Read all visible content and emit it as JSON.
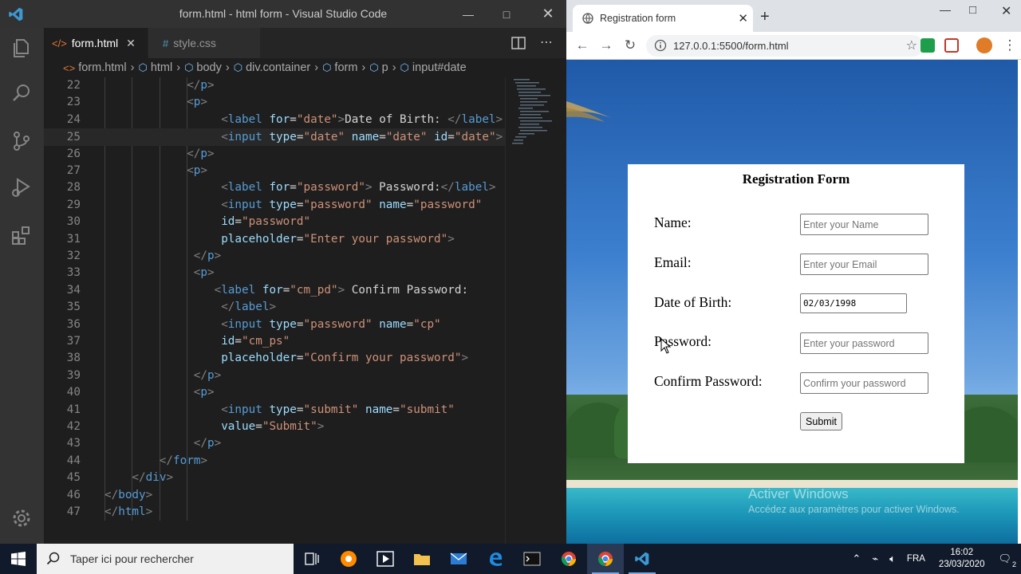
{
  "vscode": {
    "window_title": "form.html - html form - Visual Studio Code",
    "tabs": [
      {
        "label": "form.html",
        "icon": "</>",
        "active": true
      },
      {
        "label": "style.css",
        "icon": "#",
        "active": false
      }
    ],
    "breadcrumb": [
      "form.html",
      "html",
      "body",
      "div.container",
      "form",
      "p",
      "input#date"
    ],
    "code_lines": [
      {
        "n": "22",
        "indent": 12,
        "tokens": [
          [
            "t",
            "</"
          ],
          [
            "n",
            "p"
          ],
          [
            "t",
            ">"
          ]
        ]
      },
      {
        "n": "23",
        "indent": 12,
        "tokens": [
          [
            "t",
            "<"
          ],
          [
            "n",
            "p"
          ],
          [
            "t",
            ">"
          ]
        ]
      },
      {
        "n": "24",
        "indent": 17,
        "tokens": [
          [
            "t",
            "<"
          ],
          [
            "n",
            "label"
          ],
          [
            "x",
            " "
          ],
          [
            "a",
            "for"
          ],
          [
            "x",
            "="
          ],
          [
            "s",
            "\"date\""
          ],
          [
            "t",
            ">"
          ],
          [
            "x",
            "Date of Birth: "
          ],
          [
            "t",
            "</"
          ],
          [
            "n",
            "label"
          ],
          [
            "t",
            ">"
          ]
        ]
      },
      {
        "n": "25",
        "indent": 17,
        "tokens": [
          [
            "t",
            "<"
          ],
          [
            "n",
            "input"
          ],
          [
            "x",
            " "
          ],
          [
            "a",
            "type"
          ],
          [
            "x",
            "="
          ],
          [
            "s",
            "\"date\""
          ],
          [
            "x",
            " "
          ],
          [
            "a",
            "name"
          ],
          [
            "x",
            "="
          ],
          [
            "s",
            "\"date\""
          ],
          [
            "x",
            " "
          ],
          [
            "a",
            "id"
          ],
          [
            "x",
            "="
          ],
          [
            "s",
            "\"date\""
          ],
          [
            "t",
            ">"
          ]
        ]
      },
      {
        "n": "26",
        "indent": 12,
        "tokens": [
          [
            "t",
            "</"
          ],
          [
            "n",
            "p"
          ],
          [
            "t",
            ">"
          ]
        ]
      },
      {
        "n": "27",
        "indent": 12,
        "tokens": [
          [
            "t",
            "<"
          ],
          [
            "n",
            "p"
          ],
          [
            "t",
            ">"
          ]
        ]
      },
      {
        "n": "28",
        "indent": 17,
        "tokens": [
          [
            "t",
            "<"
          ],
          [
            "n",
            "label"
          ],
          [
            "x",
            " "
          ],
          [
            "a",
            "for"
          ],
          [
            "x",
            "="
          ],
          [
            "s",
            "\"password\""
          ],
          [
            "t",
            ">"
          ],
          [
            "x",
            " Password:"
          ],
          [
            "t",
            "</"
          ],
          [
            "n",
            "label"
          ],
          [
            "t",
            ">"
          ]
        ]
      },
      {
        "n": "29",
        "indent": 17,
        "tokens": [
          [
            "t",
            "<"
          ],
          [
            "n",
            "input"
          ],
          [
            "x",
            " "
          ],
          [
            "a",
            "type"
          ],
          [
            "x",
            "="
          ],
          [
            "s",
            "\"password\""
          ],
          [
            "x",
            " "
          ],
          [
            "a",
            "name"
          ],
          [
            "x",
            "="
          ],
          [
            "s",
            "\"password\""
          ]
        ]
      },
      {
        "n": "30",
        "indent": 17,
        "tokens": [
          [
            "a",
            "id"
          ],
          [
            "x",
            "="
          ],
          [
            "s",
            "\"password\""
          ]
        ]
      },
      {
        "n": "31",
        "indent": 17,
        "tokens": [
          [
            "a",
            "placeholder"
          ],
          [
            "x",
            "="
          ],
          [
            "s",
            "\"Enter your password\""
          ],
          [
            "t",
            ">"
          ]
        ]
      },
      {
        "n": "32",
        "indent": 13,
        "tokens": [
          [
            "t",
            "</"
          ],
          [
            "n",
            "p"
          ],
          [
            "t",
            ">"
          ]
        ]
      },
      {
        "n": "33",
        "indent": 13,
        "tokens": [
          [
            "t",
            "<"
          ],
          [
            "n",
            "p"
          ],
          [
            "t",
            ">"
          ]
        ]
      },
      {
        "n": "34",
        "indent": 16,
        "tokens": [
          [
            "t",
            "<"
          ],
          [
            "n",
            "label"
          ],
          [
            "x",
            " "
          ],
          [
            "a",
            "for"
          ],
          [
            "x",
            "="
          ],
          [
            "s",
            "\"cm_pd\""
          ],
          [
            "t",
            ">"
          ],
          [
            "x",
            " Confirm Password:"
          ]
        ]
      },
      {
        "n": "35",
        "indent": 17,
        "tokens": [
          [
            "t",
            "</"
          ],
          [
            "n",
            "label"
          ],
          [
            "t",
            ">"
          ]
        ]
      },
      {
        "n": "36",
        "indent": 17,
        "tokens": [
          [
            "t",
            "<"
          ],
          [
            "n",
            "input"
          ],
          [
            "x",
            " "
          ],
          [
            "a",
            "type"
          ],
          [
            "x",
            "="
          ],
          [
            "s",
            "\"password\""
          ],
          [
            "x",
            " "
          ],
          [
            "a",
            "name"
          ],
          [
            "x",
            "="
          ],
          [
            "s",
            "\"cp\""
          ]
        ]
      },
      {
        "n": "37",
        "indent": 17,
        "tokens": [
          [
            "a",
            "id"
          ],
          [
            "x",
            "="
          ],
          [
            "s",
            "\"cm_ps\""
          ]
        ]
      },
      {
        "n": "38",
        "indent": 17,
        "tokens": [
          [
            "a",
            "placeholder"
          ],
          [
            "x",
            "="
          ],
          [
            "s",
            "\"Confirm your password\""
          ],
          [
            "t",
            ">"
          ]
        ]
      },
      {
        "n": "39",
        "indent": 13,
        "tokens": [
          [
            "t",
            "</"
          ],
          [
            "n",
            "p"
          ],
          [
            "t",
            ">"
          ]
        ]
      },
      {
        "n": "40",
        "indent": 13,
        "tokens": [
          [
            "t",
            "<"
          ],
          [
            "n",
            "p"
          ],
          [
            "t",
            ">"
          ]
        ]
      },
      {
        "n": "41",
        "indent": 17,
        "tokens": [
          [
            "t",
            "<"
          ],
          [
            "n",
            "input"
          ],
          [
            "x",
            " "
          ],
          [
            "a",
            "type"
          ],
          [
            "x",
            "="
          ],
          [
            "s",
            "\"submit\""
          ],
          [
            "x",
            " "
          ],
          [
            "a",
            "name"
          ],
          [
            "x",
            "="
          ],
          [
            "s",
            "\"submit\""
          ]
        ]
      },
      {
        "n": "42",
        "indent": 17,
        "tokens": [
          [
            "a",
            "value"
          ],
          [
            "x",
            "="
          ],
          [
            "s",
            "\"Submit\""
          ],
          [
            "t",
            ">"
          ]
        ]
      },
      {
        "n": "43",
        "indent": 13,
        "tokens": [
          [
            "t",
            "</"
          ],
          [
            "n",
            "p"
          ],
          [
            "t",
            ">"
          ]
        ]
      },
      {
        "n": "44",
        "indent": 8,
        "tokens": [
          [
            "t",
            "</"
          ],
          [
            "n",
            "form"
          ],
          [
            "t",
            ">"
          ]
        ]
      },
      {
        "n": "45",
        "indent": 4,
        "tokens": [
          [
            "t",
            "</"
          ],
          [
            "n",
            "div"
          ],
          [
            "t",
            ">"
          ]
        ]
      },
      {
        "n": "46",
        "indent": 0,
        "tokens": [
          [
            "t",
            "</"
          ],
          [
            "n",
            "body"
          ],
          [
            "t",
            ">"
          ]
        ]
      },
      {
        "n": "47",
        "indent": 0,
        "tokens": [
          [
            "t",
            "</"
          ],
          [
            "n",
            "html"
          ],
          [
            "t",
            ">"
          ]
        ]
      }
    ],
    "highlighted_line": "25"
  },
  "chrome": {
    "tab_title": "Registration form",
    "url": "127.0.0.1:5500/form.html"
  },
  "form": {
    "title": "Registration Form",
    "fields": [
      {
        "label": "Name:",
        "type": "text",
        "placeholder": "Enter your Name",
        "value": ""
      },
      {
        "label": "Email:",
        "type": "text",
        "placeholder": "Enter your Email",
        "value": ""
      },
      {
        "label": "Date of Birth:",
        "type": "text",
        "placeholder": "",
        "value": "02/03/1998"
      },
      {
        "label": "Password:",
        "type": "password",
        "placeholder": "Enter your password",
        "value": ""
      },
      {
        "label": "Confirm Password:",
        "type": "password",
        "placeholder": "Confirm your password",
        "value": ""
      }
    ],
    "submit_label": "Submit"
  },
  "watermark": {
    "title": "Activer Windows",
    "subtitle": "Accédez aux paramètres pour activer Windows."
  },
  "taskbar": {
    "search_placeholder": "Taper ici pour rechercher",
    "language": "FRA",
    "time": "16:02",
    "date": "23/03/2020",
    "notification_count": "2"
  },
  "colors": {
    "vscode_bg": "#1e1e1e",
    "tag": "#569cd6",
    "attr": "#9cdcfe",
    "string": "#ce9178",
    "text": "#d4d4d4"
  }
}
